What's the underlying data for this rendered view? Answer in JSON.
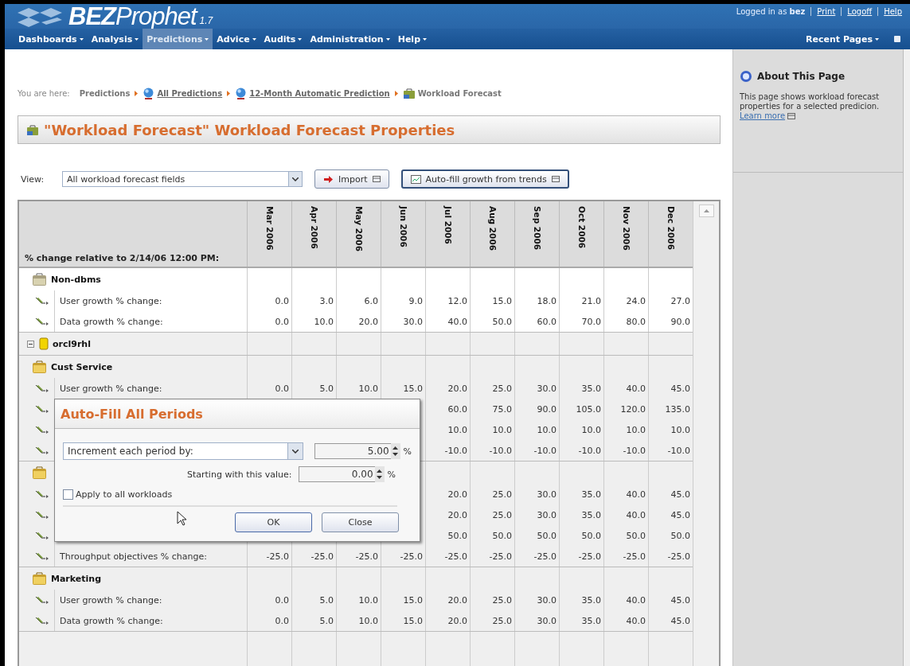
{
  "header": {
    "logo": "**BEZ**Prophet",
    "version": "1.7",
    "user_text": "Logged in as **bez**",
    "links": [
      "Print",
      "Logoff",
      "Help"
    ]
  },
  "nav": {
    "items": [
      {
        "label": "Dashboards",
        "selected": false
      },
      {
        "label": "Analysis",
        "selected": false
      },
      {
        "label": "Predictions",
        "selected": true
      },
      {
        "label": "Advice",
        "selected": false
      },
      {
        "label": "Audits",
        "selected": false
      },
      {
        "label": "Administration",
        "selected": false
      },
      {
        "label": "Help",
        "selected": false
      }
    ],
    "recent": "Recent Pages"
  },
  "breadcrumb": {
    "prefix": "You are here:",
    "items": [
      {
        "label": "Predictions",
        "kind": "plain"
      },
      {
        "label": "All Predictions",
        "kind": "link"
      },
      {
        "label": "12-Month Automatic Prediction",
        "kind": "link"
      },
      {
        "label": "Workload Forecast",
        "kind": "current"
      }
    ]
  },
  "page_title": "\"Workload Forecast\" Workload Forecast Properties",
  "toolbar": {
    "view_label": "View:",
    "view_value": "All workload forecast fields",
    "buttons": [
      {
        "label": "Import",
        "kind": "import",
        "focused": false
      },
      {
        "label": "Auto-fill growth from trends",
        "kind": "chart",
        "focused": true
      }
    ]
  },
  "table": {
    "corner": "% change relative to 2/14/06 12:00 PM:",
    "columns": [
      "Mar 2006",
      "Apr 2006",
      "May 2006",
      "Jun 2006",
      "Jul 2006",
      "Aug 2006",
      "Sep 2006",
      "Oct 2006",
      "Nov 2006",
      "Dec 2006"
    ],
    "groups": [
      {
        "name": "Non-dbms",
        "kind": "folder",
        "rows": [
          {
            "label": "User growth % change:",
            "values": [
              "0.0",
              "3.0",
              "6.0",
              "9.0",
              "12.0",
              "15.0",
              "18.0",
              "21.0",
              "24.0",
              "27.0"
            ]
          },
          {
            "label": "Data growth % change:",
            "values": [
              "0.0",
              "10.0",
              "20.0",
              "30.0",
              "40.0",
              "50.0",
              "60.0",
              "70.0",
              "80.0",
              "90.0"
            ]
          }
        ]
      },
      {
        "name": "orcl9rhl",
        "kind": "database",
        "expanded": true,
        "children": [
          {
            "name": "Cust Service",
            "kind": "workload",
            "rows": [
              {
                "label": "User growth % change:",
                "values": [
                  "0.0",
                  "5.0",
                  "10.0",
                  "15.0",
                  "20.0",
                  "25.0",
                  "30.0",
                  "35.0",
                  "40.0",
                  "45.0"
                ]
              },
              {
                "values": [
                  "60.0",
                  "75.0",
                  "90.0",
                  "105.0",
                  "120.0",
                  "135.0"
                ]
              },
              {
                "values": [
                  "10.0",
                  "10.0",
                  "10.0",
                  "10.0",
                  "10.0",
                  "10.0"
                ]
              },
              {
                "values": [
                  "-10.0",
                  "-10.0",
                  "-10.0",
                  "-10.0",
                  "-10.0",
                  "-10.0"
                ]
              }
            ]
          },
          {
            "kind": "workload",
            "rows": [
              {
                "values": [
                  "20.0",
                  "25.0",
                  "30.0",
                  "35.0",
                  "40.0",
                  "45.0"
                ]
              },
              {
                "values": [
                  "20.0",
                  "25.0",
                  "30.0",
                  "35.0",
                  "40.0",
                  "45.0"
                ]
              },
              {
                "values": [
                  "50.0",
                  "50.0",
                  "50.0",
                  "50.0",
                  "50.0",
                  "50.0"
                ]
              },
              {
                "label": "Throughput objectives % change:",
                "values": [
                  "-25.0",
                  "-25.0",
                  "-25.0",
                  "-25.0",
                  "-25.0",
                  "-25.0",
                  "-25.0",
                  "-25.0",
                  "-25.0",
                  "-25.0"
                ]
              }
            ]
          },
          {
            "name": "Marketing",
            "kind": "workload",
            "rows": [
              {
                "label": "User growth % change:",
                "values": [
                  "0.0",
                  "5.0",
                  "10.0",
                  "15.0",
                  "20.0",
                  "25.0",
                  "30.0",
                  "35.0",
                  "40.0",
                  "45.0"
                ]
              },
              {
                "label": "Data growth % change:",
                "values": [
                  "0.0",
                  "5.0",
                  "10.0",
                  "15.0",
                  "20.0",
                  "25.0",
                  "30.0",
                  "35.0",
                  "40.0",
                  "45.0"
                ]
              }
            ]
          }
        ]
      }
    ]
  },
  "dialog": {
    "title": "Auto-Fill All Periods",
    "mode": "Increment each period by:",
    "increment": "5.00",
    "increment_unit": "%",
    "start_label": "Starting with this value:",
    "start": "0.00",
    "start_unit": "%",
    "apply_all": {
      "label": "Apply to all workloads",
      "checked": false
    },
    "buttons": [
      "OK",
      "Close"
    ]
  },
  "about": {
    "title": "About This Page",
    "text": "This page shows workload forecast properties for a selected predicion.",
    "link": "Learn more"
  }
}
